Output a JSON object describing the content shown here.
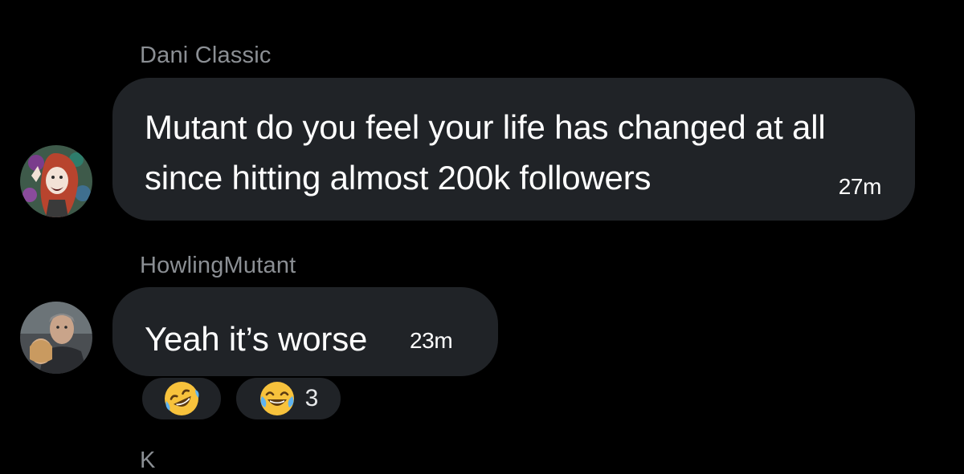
{
  "messages": [
    {
      "sender": "Dani Classic",
      "text": "Mutant do you feel your life has changed at all since hitting almost 200k followers",
      "time": "27m"
    },
    {
      "sender": "HowlingMutant",
      "text": "Yeah it’s worse",
      "time": "23m"
    }
  ],
  "reactions": [
    {
      "emoji": "rolling-on-floor-laughing",
      "count": ""
    },
    {
      "emoji": "face-with-tears-of-joy",
      "count": "3"
    }
  ],
  "next_sender": "K"
}
